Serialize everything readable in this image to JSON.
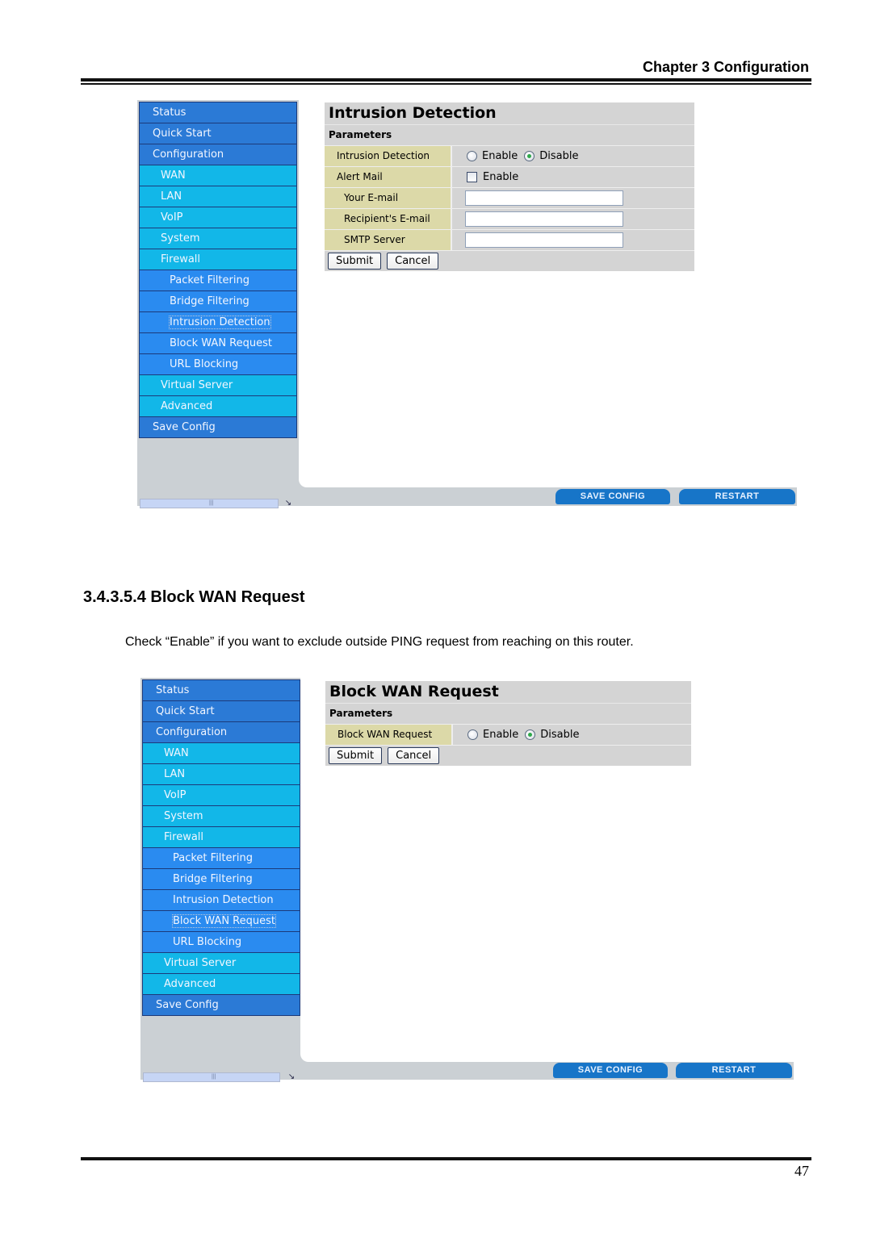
{
  "header": {
    "chapter": "Chapter 3 Configuration"
  },
  "section": {
    "heading": "3.4.3.5.4 Block WAN Request",
    "body": "Check “Enable” if you want to exclude outside PING request from reaching on this router."
  },
  "footer": {
    "page_number": "47"
  },
  "colors": {
    "nav_top": "#2b7ad6",
    "nav_sub": "#12b7e8",
    "nav_firewall_sub": "#2a8bf0",
    "label_cell": "#dcd9a8",
    "action_button": "#1775c8"
  },
  "screenshot1": {
    "nav": [
      {
        "label": "Status",
        "level": 0
      },
      {
        "label": "Quick Start",
        "level": 0
      },
      {
        "label": "Configuration",
        "level": 0
      },
      {
        "label": "WAN",
        "level": 1
      },
      {
        "label": "LAN",
        "level": 1
      },
      {
        "label": "VoIP",
        "level": 1
      },
      {
        "label": "System",
        "level": 1
      },
      {
        "label": "Firewall",
        "level": 1
      },
      {
        "label": "Packet Filtering",
        "level": 2
      },
      {
        "label": "Bridge Filtering",
        "level": 2
      },
      {
        "label": "Intrusion Detection",
        "level": 2,
        "selected": true
      },
      {
        "label": "Block WAN Request",
        "level": 2
      },
      {
        "label": "URL Blocking",
        "level": 2
      },
      {
        "label": "Virtual Server",
        "level": 1
      },
      {
        "label": "Advanced",
        "level": 1
      },
      {
        "label": "Save Config",
        "level": 0
      }
    ],
    "panel_title": "Intrusion Detection",
    "panel_subtitle": "Parameters",
    "rows": {
      "intrusion_detection": {
        "label": "Intrusion Detection",
        "enable": "Enable",
        "disable": "Disable",
        "selected": "Disable"
      },
      "alert_mail": {
        "label": "Alert Mail",
        "checkbox": "Enable",
        "checked": false
      },
      "your_email": {
        "label": "Your E-mail",
        "value": ""
      },
      "recipient_email": {
        "label": "Recipient's E-mail",
        "value": ""
      },
      "smtp_server": {
        "label": "SMTP Server",
        "value": ""
      }
    },
    "submit": "Submit",
    "cancel": "Cancel",
    "save_config": "SAVE CONFIG",
    "restart": "RESTART"
  },
  "screenshot2": {
    "nav": [
      {
        "label": "Status",
        "level": 0
      },
      {
        "label": "Quick Start",
        "level": 0
      },
      {
        "label": "Configuration",
        "level": 0
      },
      {
        "label": "WAN",
        "level": 1
      },
      {
        "label": "LAN",
        "level": 1
      },
      {
        "label": "VoIP",
        "level": 1
      },
      {
        "label": "System",
        "level": 1
      },
      {
        "label": "Firewall",
        "level": 1
      },
      {
        "label": "Packet Filtering",
        "level": 2
      },
      {
        "label": "Bridge Filtering",
        "level": 2
      },
      {
        "label": "Intrusion Detection",
        "level": 2
      },
      {
        "label": "Block WAN Request",
        "level": 2,
        "selected": true
      },
      {
        "label": "URL Blocking",
        "level": 2
      },
      {
        "label": "Virtual Server",
        "level": 1
      },
      {
        "label": "Advanced",
        "level": 1
      },
      {
        "label": "Save Config",
        "level": 0
      }
    ],
    "panel_title": "Block WAN Request",
    "panel_subtitle": "Parameters",
    "rows": {
      "block_wan": {
        "label": "Block WAN Request",
        "enable": "Enable",
        "disable": "Disable",
        "selected": "Disable"
      }
    },
    "submit": "Submit",
    "cancel": "Cancel",
    "save_config": "SAVE CONFIG",
    "restart": "RESTART"
  }
}
